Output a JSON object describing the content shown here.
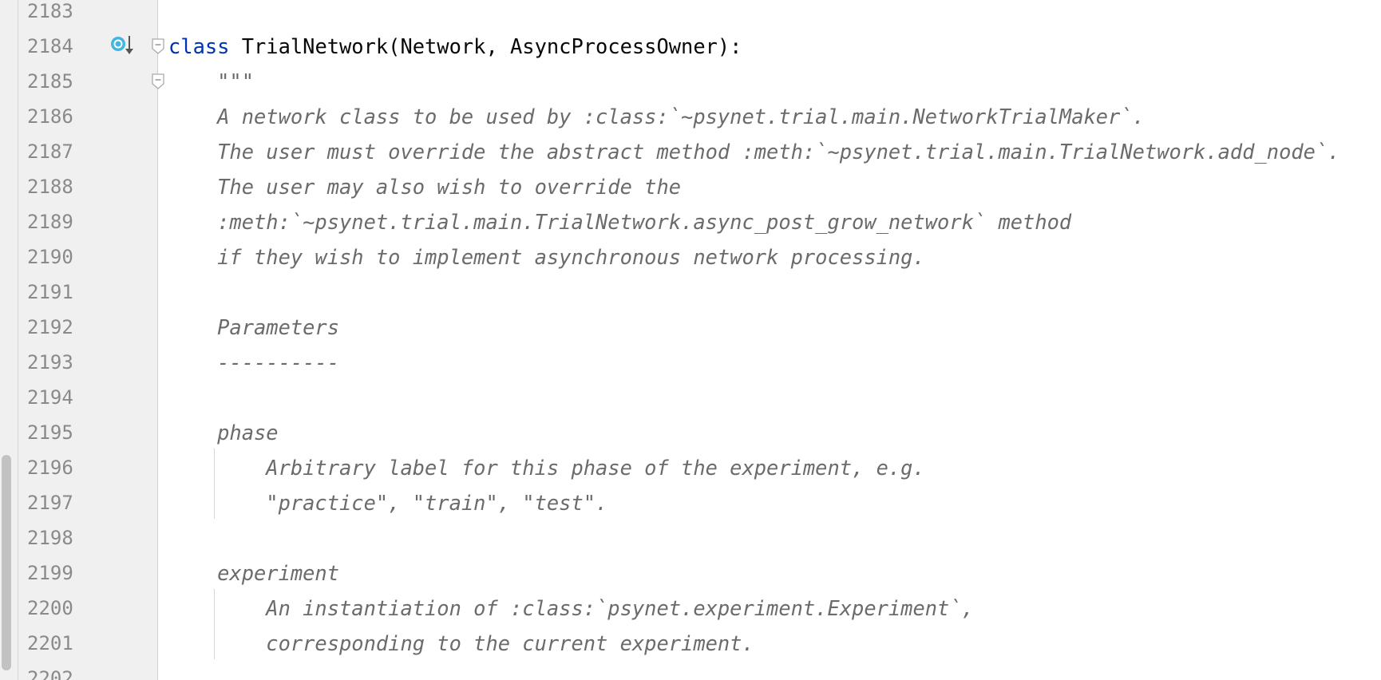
{
  "editor": {
    "gutter_icon": "override-method-icon",
    "fold_icons": [
      "fold-start-icon",
      "fold-doc-icon"
    ],
    "lines": [
      {
        "num": "2183",
        "parts": []
      },
      {
        "num": "2184",
        "parts": [
          {
            "t": "class",
            "c": "kw"
          },
          {
            "t": " TrialNetwork(Network, AsyncProcessOwner):",
            "c": ""
          }
        ]
      },
      {
        "num": "2185",
        "parts": [
          {
            "t": "    \"\"\"",
            "c": "doc"
          }
        ]
      },
      {
        "num": "2186",
        "parts": [
          {
            "t": "    A network class to be used by :class:`~psynet.trial.main.NetworkTrialMaker`.",
            "c": "doc"
          }
        ]
      },
      {
        "num": "2187",
        "parts": [
          {
            "t": "    The user must override the abstract method :meth:`~psynet.trial.main.TrialNetwork.add_node`.",
            "c": "doc"
          }
        ]
      },
      {
        "num": "2188",
        "parts": [
          {
            "t": "    The user may also wish to override the",
            "c": "doc"
          }
        ]
      },
      {
        "num": "2189",
        "parts": [
          {
            "t": "    :meth:`~psynet.trial.main.TrialNetwork.async_post_grow_network` method",
            "c": "doc"
          }
        ]
      },
      {
        "num": "2190",
        "parts": [
          {
            "t": "    if they wish to implement asynchronous network processing.",
            "c": "doc"
          }
        ]
      },
      {
        "num": "2191",
        "parts": []
      },
      {
        "num": "2192",
        "parts": [
          {
            "t": "    Parameters",
            "c": "doc"
          }
        ]
      },
      {
        "num": "2193",
        "parts": [
          {
            "t": "    ----------",
            "c": "doc"
          }
        ]
      },
      {
        "num": "2194",
        "parts": []
      },
      {
        "num": "2195",
        "parts": [
          {
            "t": "    phase",
            "c": "doc"
          }
        ]
      },
      {
        "num": "2196",
        "parts": [
          {
            "t": "        Arbitrary label for this phase of the experiment, e.g.",
            "c": "doc"
          }
        ]
      },
      {
        "num": "2197",
        "parts": [
          {
            "t": "        \"practice\", \"train\", \"test\".",
            "c": "doc"
          }
        ]
      },
      {
        "num": "2198",
        "parts": []
      },
      {
        "num": "2199",
        "parts": [
          {
            "t": "    experiment",
            "c": "doc"
          }
        ]
      },
      {
        "num": "2200",
        "parts": [
          {
            "t": "        An instantiation of :class:`psynet.experiment.Experiment`,",
            "c": "doc"
          }
        ]
      },
      {
        "num": "2201",
        "parts": [
          {
            "t": "        corresponding to the current experiment.",
            "c": "doc"
          }
        ]
      },
      {
        "num": "2202",
        "parts": []
      }
    ]
  }
}
